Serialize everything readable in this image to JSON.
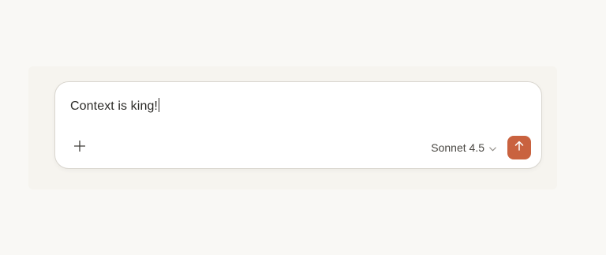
{
  "composer": {
    "input_value": "Context is king!",
    "model_label": "Sonnet 4.5",
    "icons": {
      "add": "plus-icon",
      "model_dropdown": "chevron-down-icon",
      "send": "arrow-up-icon"
    }
  },
  "colors": {
    "page_background": "#f9f8f5",
    "composer_background": "#ffffff",
    "composer_border": "#d9d6cf",
    "send_button": "#c9623f",
    "text": "#2c2b28"
  }
}
